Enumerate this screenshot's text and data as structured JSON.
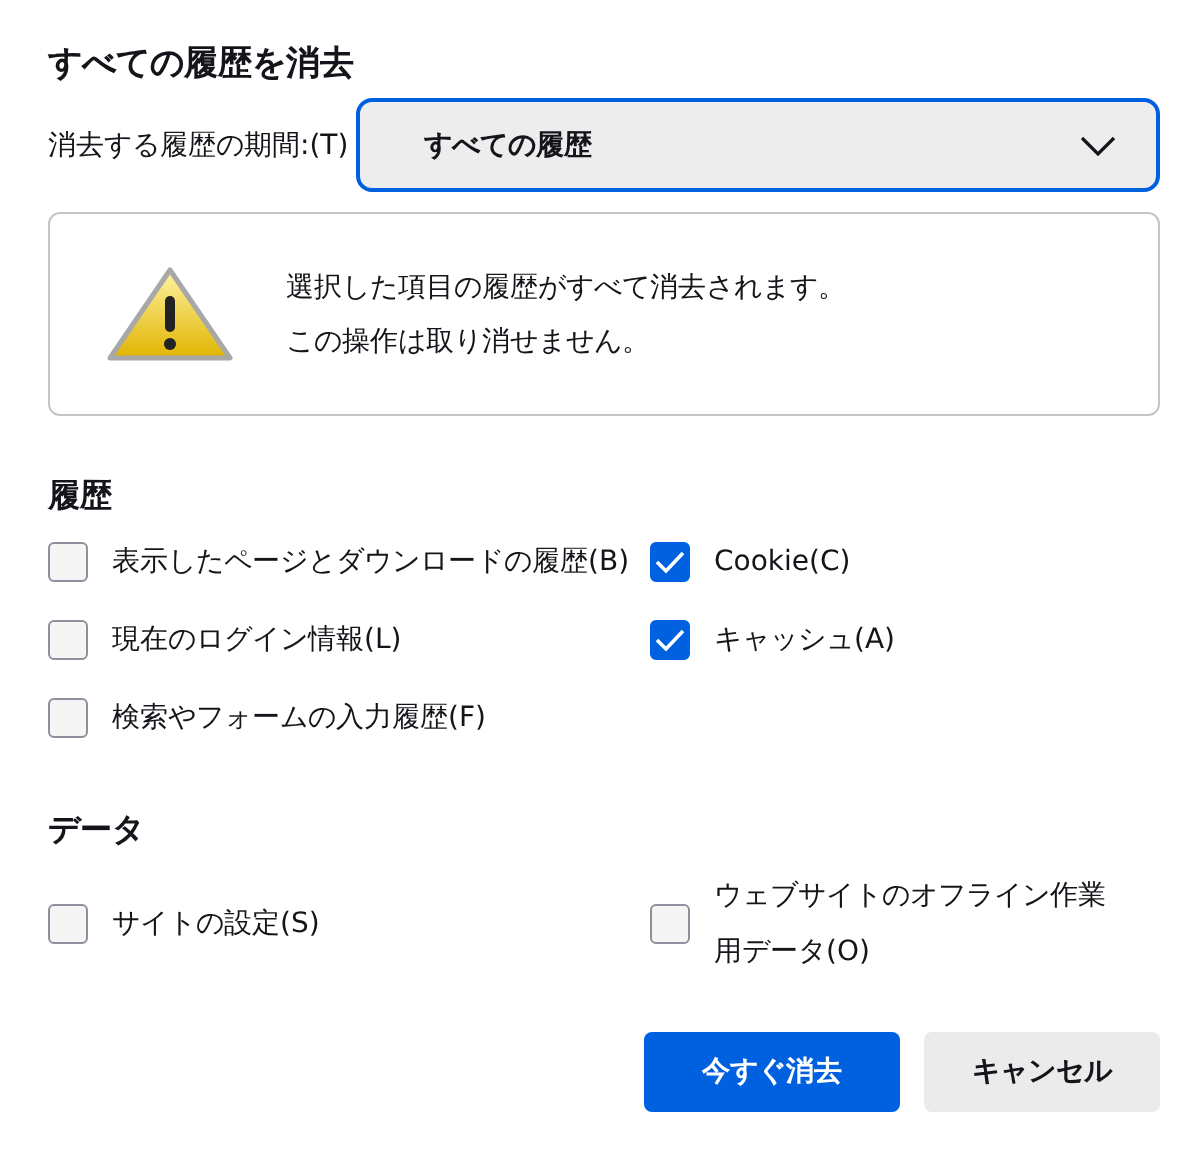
{
  "title": "すべての履歴を消去",
  "range": {
    "label": "消去する履歴の期間:(T)",
    "value": "すべての履歴",
    "focused": true
  },
  "warning": {
    "lines": [
      "選択した項目の履歴がすべて消去されます。",
      "この操作は取り消せません。"
    ]
  },
  "sections": [
    {
      "heading": "履歴",
      "items": [
        {
          "label": "表示したページとダウンロードの履歴(B)",
          "checked": false
        },
        {
          "label": "Cookie(C)",
          "checked": true
        },
        {
          "label": "現在のログイン情報(L)",
          "checked": false
        },
        {
          "label": "キャッシュ(A)",
          "checked": true
        },
        {
          "label": "検索やフォームの入力履歴(F)",
          "checked": false
        }
      ]
    },
    {
      "heading": "データ",
      "items": [
        {
          "label": "サイトの設定(S)",
          "checked": false
        },
        {
          "label": "ウェブサイトのオフライン作業用データ(O)",
          "checked": false
        }
      ]
    }
  ],
  "buttons": [
    {
      "label": "今すぐ消去",
      "kind": "primary"
    },
    {
      "label": "キャンセル",
      "kind": "secondary"
    }
  ]
}
